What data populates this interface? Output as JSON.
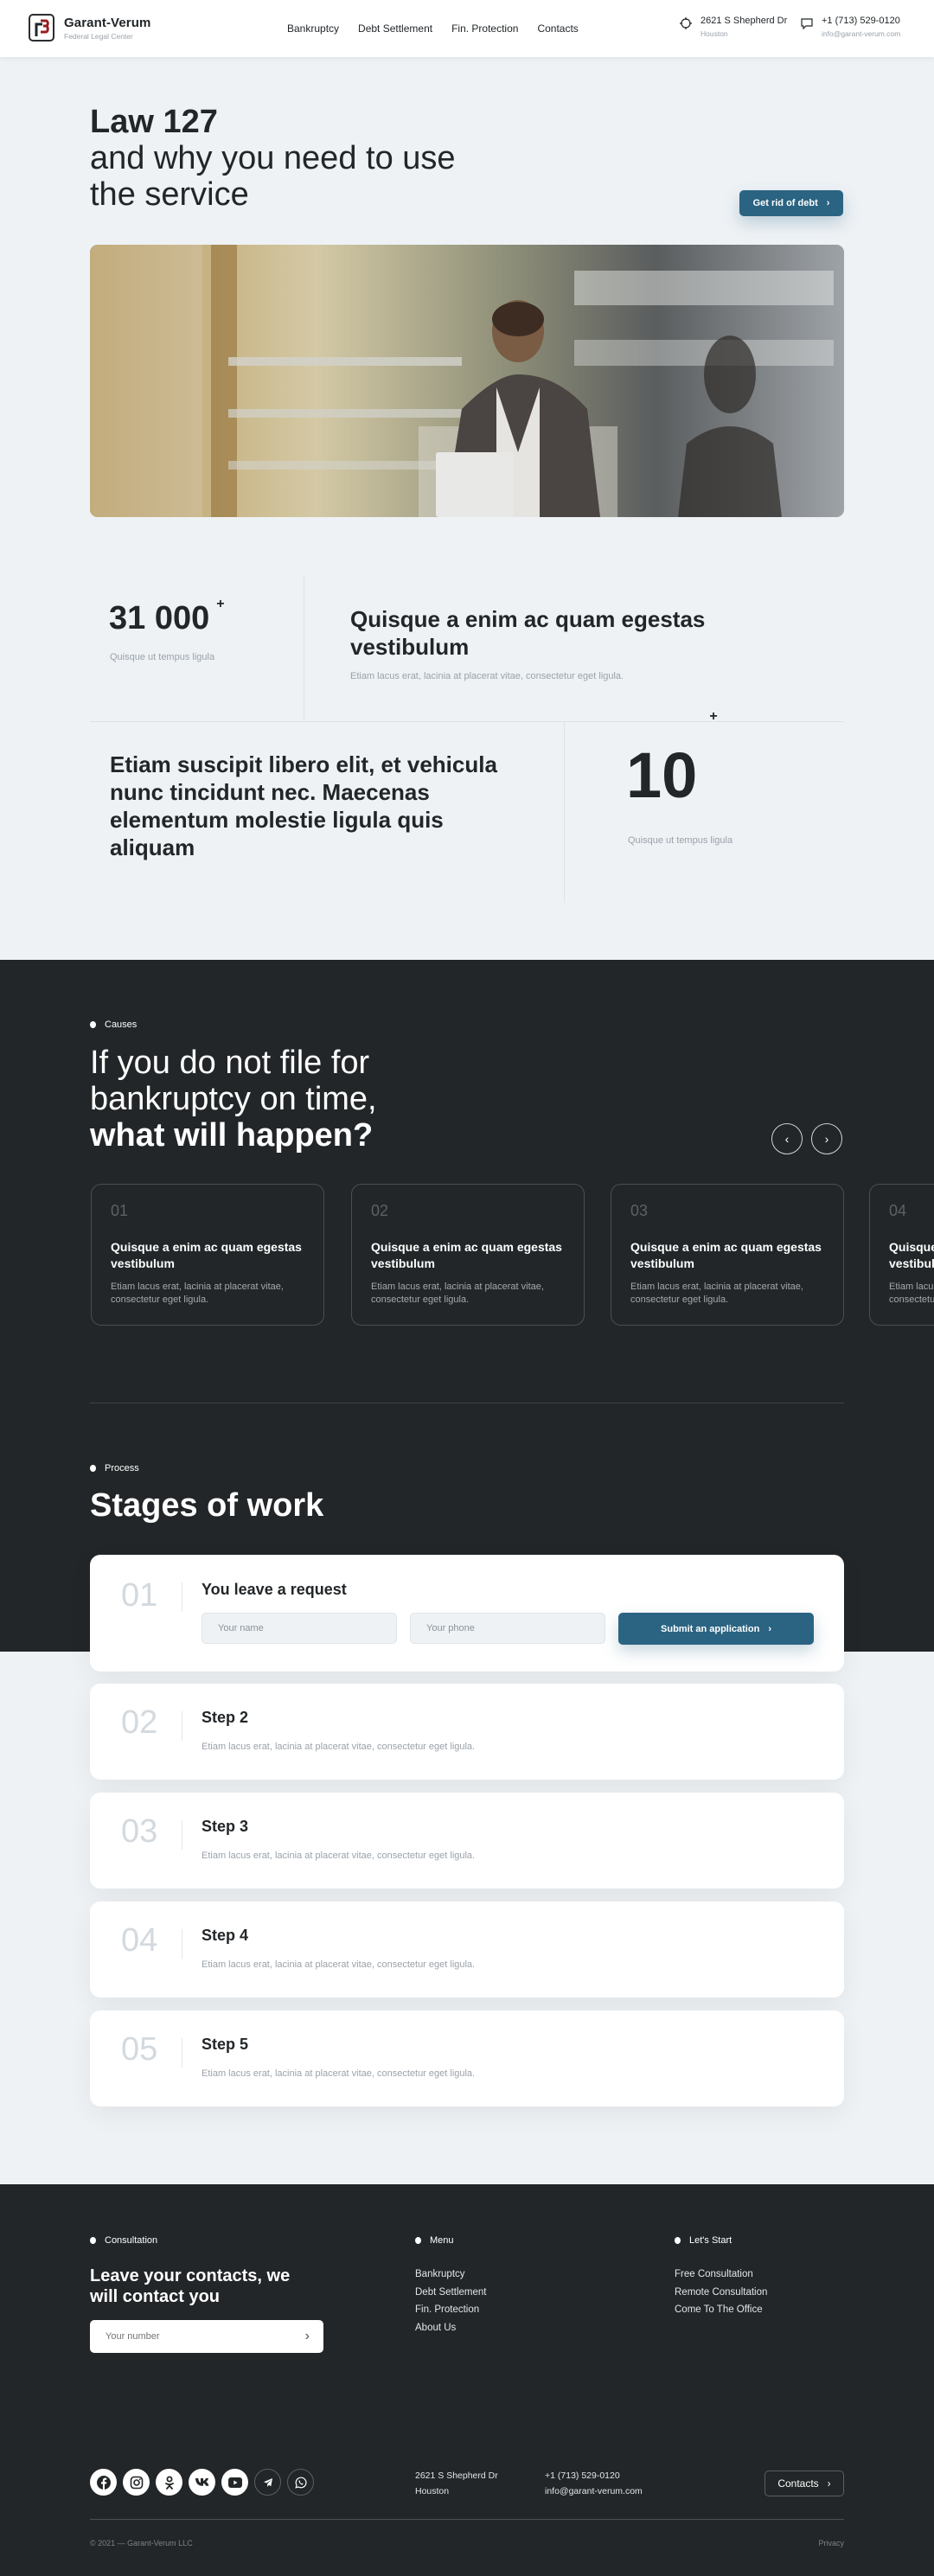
{
  "header": {
    "brand_name": "Garant-Verum",
    "brand_subtitle": "Federal Legal Center",
    "nav": [
      "Bankruptcy",
      "Debt Settlement",
      "Fin. Protection",
      "Contacts"
    ],
    "address_line1": "2621 S Shepherd Dr",
    "address_line2": "Houston",
    "phone": "+1 (713) 529-0120",
    "email": "info@garant-verum.com"
  },
  "hero": {
    "title_bold": "Law 127",
    "title_line2": "and why you need to use",
    "title_line3": "the service",
    "cta_label": "Get rid of debt",
    "image_alt": "Man working on laptop on balcony"
  },
  "stats": {
    "stat1_value": "31 000",
    "stat1_suffix": "+",
    "stat1_caption": "Quisque ut tempus ligula",
    "block1_title": "Quisque a enim ac quam egestas vestibulum",
    "block1_text": "Etiam lacus erat, lacinia at placerat vitae, consectetur eget ligula.",
    "block2_title": "Etiam suscipit libero elit, et vehicula nunc tincidunt nec. Maecenas elementum molestie ligula quis aliquam",
    "stat2_value": "10",
    "stat2_suffix": "+",
    "stat2_caption": "Quisque ut tempus ligula"
  },
  "causes": {
    "label": "Causes",
    "title_line1": "If you do not file for",
    "title_line2": "bankruptcy on time,",
    "title_bold": "what will happen?",
    "cards": [
      {
        "num": "01",
        "title": "Quisque a enim ac quam egestas vestibulum",
        "text": "Etiam lacus erat, lacinia at placerat vitae, consectetur eget ligula."
      },
      {
        "num": "02",
        "title": "Quisque a enim ac quam egestas vestibulum",
        "text": "Etiam lacus erat, lacinia at placerat vitae, consectetur eget ligula."
      },
      {
        "num": "03",
        "title": "Quisque a enim ac quam egestas vestibulum",
        "text": "Etiam lacus erat, lacinia at placerat vitae, consectetur eget ligula."
      },
      {
        "num": "04",
        "title": "Quisque a enim ac quam egestas vestibulum",
        "text": "Etiam lacus erat, lacinia at placerat vitae, consectetur eget ligula."
      }
    ]
  },
  "process": {
    "label": "Process",
    "title": "Stages of work",
    "step1": {
      "num": "01",
      "title": "You leave a request",
      "name_placeholder": "Your name",
      "phone_placeholder": "Your phone",
      "submit_label": "Submit an application"
    },
    "steps": [
      {
        "num": "02",
        "title": "Step 2",
        "text": "Etiam lacus erat, lacinia at placerat vitae, consectetur eget ligula."
      },
      {
        "num": "03",
        "title": "Step 3",
        "text": "Etiam lacus erat, lacinia at placerat vitae, consectetur eget ligula."
      },
      {
        "num": "04",
        "title": "Step 4",
        "text": "Etiam lacus erat, lacinia at placerat vitae, consectetur eget ligula."
      },
      {
        "num": "05",
        "title": "Step 5",
        "text": "Etiam lacus erat, lacinia at placerat vitae, consectetur eget ligula."
      }
    ]
  },
  "footer": {
    "consult_label": "Consultation",
    "consult_title": "Leave your contacts, we will contact you",
    "number_placeholder": "Your number",
    "menu_label": "Menu",
    "menu_items": [
      "Bankruptcy",
      "Debt Settlement",
      "Fin. Protection",
      "About Us"
    ],
    "start_label": "Let's Start",
    "start_items": [
      "Free Consultation",
      "Remote Consultation",
      "Come To The Office"
    ],
    "social": [
      "facebook",
      "instagram",
      "odnoklassniki",
      "vk",
      "youtube",
      "telegram",
      "whatsapp"
    ],
    "address_line1": "2621 S Shepherd Dr",
    "address_line2": "Houston",
    "phone": "+1 (713) 529-0120",
    "email": "info@garant-verum.com",
    "contacts_button": "Contacts",
    "copyright": "© 2021 — Garant-Verum LLC",
    "privacy": "Privacy"
  },
  "colors": {
    "accent": "#2b6482",
    "dark_bg": "#222628",
    "light_bg": "#eef2f5"
  }
}
